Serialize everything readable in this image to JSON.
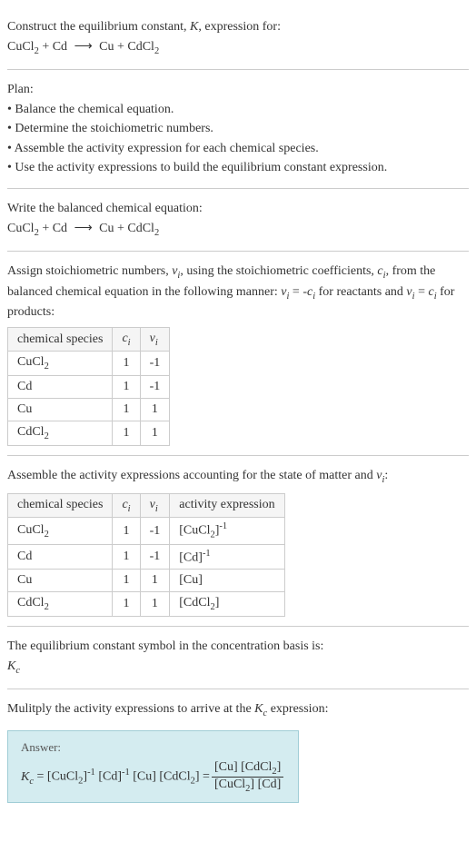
{
  "intro": {
    "line1": "Construct the equilibrium constant, K, expression for:",
    "equation": "CuCl₂ + Cd ⟶ Cu + CdCl₂"
  },
  "plan": {
    "heading": "Plan:",
    "item1": "• Balance the chemical equation.",
    "item2": "• Determine the stoichiometric numbers.",
    "item3": "• Assemble the activity expression for each chemical species.",
    "item4": "• Use the activity expressions to build the equilibrium constant expression."
  },
  "balanced": {
    "heading": "Write the balanced chemical equation:",
    "equation": "CuCl₂ + Cd ⟶ Cu + CdCl₂"
  },
  "stoich": {
    "text1": "Assign stoichiometric numbers, νᵢ, using the stoichiometric coefficients, cᵢ, from the balanced chemical equation in the following manner: νᵢ = -cᵢ for reactants and νᵢ = cᵢ for products:",
    "headers": {
      "h1": "chemical species",
      "h2": "cᵢ",
      "h3": "νᵢ"
    },
    "rows": [
      {
        "species": "CuCl₂",
        "c": "1",
        "v": "-1"
      },
      {
        "species": "Cd",
        "c": "1",
        "v": "-1"
      },
      {
        "species": "Cu",
        "c": "1",
        "v": "1"
      },
      {
        "species": "CdCl₂",
        "c": "1",
        "v": "1"
      }
    ]
  },
  "activity": {
    "text1": "Assemble the activity expressions accounting for the state of matter and νᵢ:",
    "headers": {
      "h1": "chemical species",
      "h2": "cᵢ",
      "h3": "νᵢ",
      "h4": "activity expression"
    },
    "rows": [
      {
        "species": "CuCl₂",
        "c": "1",
        "v": "-1",
        "expr": "[CuCl₂]⁻¹"
      },
      {
        "species": "Cd",
        "c": "1",
        "v": "-1",
        "expr": "[Cd]⁻¹"
      },
      {
        "species": "Cu",
        "c": "1",
        "v": "1",
        "expr": "[Cu]"
      },
      {
        "species": "CdCl₂",
        "c": "1",
        "v": "1",
        "expr": "[CdCl₂]"
      }
    ]
  },
  "symbol": {
    "text1": "The equilibrium constant symbol in the concentration basis is:",
    "text2": "K_c"
  },
  "multiply": {
    "text1": "Mulitply the activity expressions to arrive at the K_c expression:"
  },
  "answer": {
    "label": "Answer:",
    "lhs": "K_c = [CuCl₂]⁻¹ [Cd]⁻¹ [Cu] [CdCl₂] = ",
    "num": "[Cu] [CdCl₂]",
    "den": "[CuCl₂] [Cd]"
  }
}
